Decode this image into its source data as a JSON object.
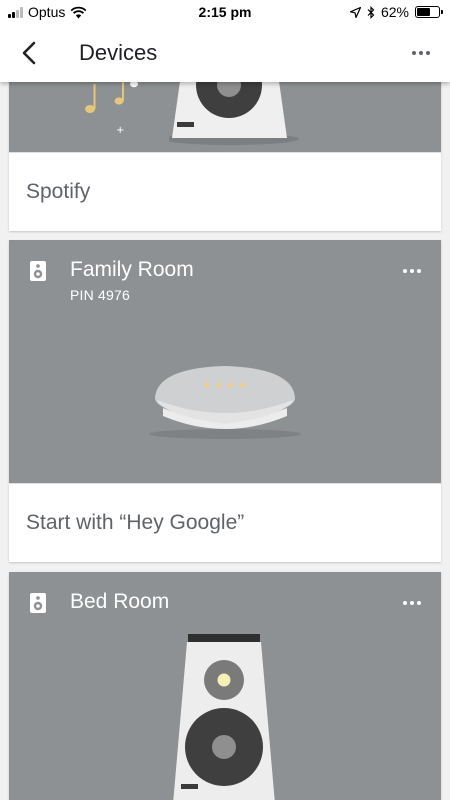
{
  "status_bar": {
    "carrier": "Optus",
    "time": "2:15 pm",
    "battery": "62%",
    "battery_level": 0.62
  },
  "app_bar": {
    "title": "Devices",
    "back_icon": "arrow-back-icon",
    "menu_icon": "more-horiz-icon"
  },
  "cards": [
    {
      "footer_text": "Spotify"
    },
    {
      "name": "Family Room",
      "pin": "PIN 4976",
      "footer_text": "Start with “Hey Google”"
    },
    {
      "name": "Bed Room"
    }
  ],
  "colors": {
    "media_background": "#8e9193",
    "card_background": "#ffffff",
    "page_background": "#f1f1f1",
    "footer_text": "#5f6368"
  }
}
